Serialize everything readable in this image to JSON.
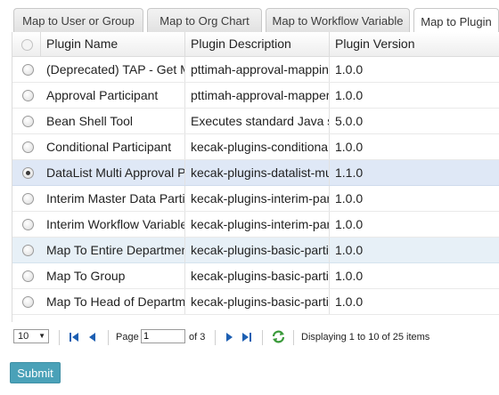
{
  "tabs": [
    {
      "label": "Map to User or Group",
      "active": false
    },
    {
      "label": "Map to Org Chart",
      "active": false
    },
    {
      "label": "Map to Workflow Variable",
      "active": false
    },
    {
      "label": "Map to Plugin",
      "active": true
    }
  ],
  "grid": {
    "columns": [
      "Plugin Name",
      "Plugin Description",
      "Plugin Version"
    ],
    "rows": [
      {
        "name": "(Deprecated) TAP - Get Ma",
        "description": "pttimah-approval-mapping",
        "version": "1.0.0",
        "selected": false
      },
      {
        "name": "Approval Participant",
        "description": "pttimah-approval-mapper",
        "version": "1.0.0",
        "selected": false
      },
      {
        "name": "Bean Shell Tool",
        "description": "Executes standard Java sy",
        "version": "5.0.0",
        "selected": false
      },
      {
        "name": "Conditional Participant",
        "description": "kecak-plugins-conditional-p",
        "version": "1.0.0",
        "selected": false
      },
      {
        "name": "DataList Multi Approval Par",
        "description": "kecak-plugins-datalist-multi",
        "version": "1.1.0",
        "selected": true
      },
      {
        "name": "Interim Master Data Particip",
        "description": "kecak-plugins-interim-partic",
        "version": "1.0.0",
        "selected": false
      },
      {
        "name": "Interim Workflow Variable P",
        "description": "kecak-plugins-interim-partic",
        "version": "1.0.0",
        "selected": false
      },
      {
        "name": "Map To Entire Department",
        "description": "kecak-plugins-basic-particip",
        "version": "1.0.0",
        "selected": false
      },
      {
        "name": "Map To Group",
        "description": "kecak-plugins-basic-particip",
        "version": "1.0.0",
        "selected": false
      },
      {
        "name": "Map To Head of Departmen",
        "description": "kecak-plugins-basic-particip",
        "version": "1.0.0",
        "selected": false
      }
    ]
  },
  "pager": {
    "page_size": "10",
    "page_label": "Page",
    "current_page": "1",
    "of_pages": "of 3",
    "display_text": "Displaying 1 to 10 of 25 items"
  },
  "colors": {
    "accent": "#4aa1b8",
    "selected_row": "#dfe8f6",
    "pager_icon": "#1d5fb2",
    "refresh_icon": "#3a9a3a"
  },
  "submit_label": "Submit"
}
